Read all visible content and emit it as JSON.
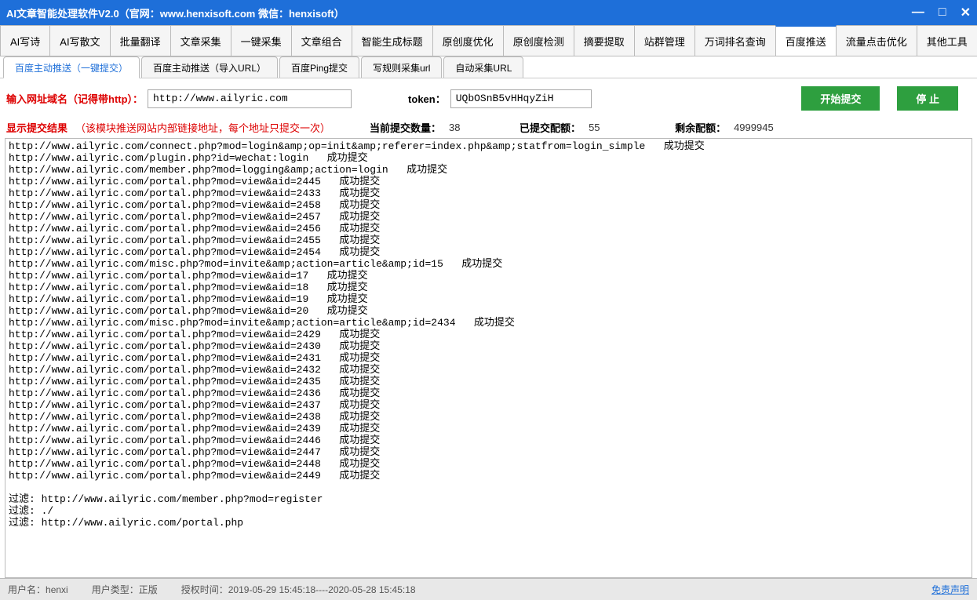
{
  "window": {
    "title": "AI文章智能处理软件V2.0（官网：www.henxisoft.com  微信：henxisoft）"
  },
  "main_tabs": [
    "AI写诗",
    "AI写散文",
    "批量翻译",
    "文章采集",
    "一键采集",
    "文章组合",
    "智能生成标题",
    "原创度优化",
    "原创度检测",
    "摘要提取",
    "站群管理",
    "万词排名查询",
    "百度推送",
    "流量点击优化",
    "其他工具"
  ],
  "main_tab_active": 12,
  "sub_tabs": [
    "百度主动推送（一键提交）",
    "百度主动推送（导入URL）",
    "百度Ping提交",
    "写规则采集url",
    "自动采集URL"
  ],
  "sub_tab_active": 0,
  "form": {
    "url_label": "输入网址域名（记得带http）：",
    "url_value": "http://www.ailyric.com",
    "token_label": "token：",
    "token_value": "UQbOSnB5vHHqyZiH",
    "start_btn": "开始提交",
    "stop_btn": "停  止"
  },
  "stats": {
    "result_label": "显示提交结果",
    "result_note": "（该模块推送网站内部链接地址，每个地址只提交一次）",
    "current_label": "当前提交数量：",
    "current_value": "38",
    "submitted_label": "已提交配额：",
    "submitted_value": "55",
    "remaining_label": "剩余配额：",
    "remaining_value": "4999945"
  },
  "log_lines": [
    "http://www.ailyric.com/connect.php?mod=login&amp;op=init&amp;referer=index.php&amp;statfrom=login_simple   成功提交",
    "http://www.ailyric.com/plugin.php?id=wechat:login   成功提交",
    "http://www.ailyric.com/member.php?mod=logging&amp;action=login   成功提交",
    "http://www.ailyric.com/portal.php?mod=view&aid=2445   成功提交",
    "http://www.ailyric.com/portal.php?mod=view&aid=2433   成功提交",
    "http://www.ailyric.com/portal.php?mod=view&aid=2458   成功提交",
    "http://www.ailyric.com/portal.php?mod=view&aid=2457   成功提交",
    "http://www.ailyric.com/portal.php?mod=view&aid=2456   成功提交",
    "http://www.ailyric.com/portal.php?mod=view&aid=2455   成功提交",
    "http://www.ailyric.com/portal.php?mod=view&aid=2454   成功提交",
    "http://www.ailyric.com/misc.php?mod=invite&amp;action=article&amp;id=15   成功提交",
    "http://www.ailyric.com/portal.php?mod=view&aid=17   成功提交",
    "http://www.ailyric.com/portal.php?mod=view&aid=18   成功提交",
    "http://www.ailyric.com/portal.php?mod=view&aid=19   成功提交",
    "http://www.ailyric.com/portal.php?mod=view&aid=20   成功提交",
    "http://www.ailyric.com/misc.php?mod=invite&amp;action=article&amp;id=2434   成功提交",
    "http://www.ailyric.com/portal.php?mod=view&aid=2429   成功提交",
    "http://www.ailyric.com/portal.php?mod=view&aid=2430   成功提交",
    "http://www.ailyric.com/portal.php?mod=view&aid=2431   成功提交",
    "http://www.ailyric.com/portal.php?mod=view&aid=2432   成功提交",
    "http://www.ailyric.com/portal.php?mod=view&aid=2435   成功提交",
    "http://www.ailyric.com/portal.php?mod=view&aid=2436   成功提交",
    "http://www.ailyric.com/portal.php?mod=view&aid=2437   成功提交",
    "http://www.ailyric.com/portal.php?mod=view&aid=2438   成功提交",
    "http://www.ailyric.com/portal.php?mod=view&aid=2439   成功提交",
    "http://www.ailyric.com/portal.php?mod=view&aid=2446   成功提交",
    "http://www.ailyric.com/portal.php?mod=view&aid=2447   成功提交",
    "http://www.ailyric.com/portal.php?mod=view&aid=2448   成功提交",
    "http://www.ailyric.com/portal.php?mod=view&aid=2449   成功提交",
    "",
    "过滤: http://www.ailyric.com/member.php?mod=register",
    "过滤: ./",
    "过滤: http://www.ailyric.com/portal.php"
  ],
  "status": {
    "user_label": "用户名：",
    "user_value": "henxi",
    "type_label": "用户类型：",
    "type_value": "正版",
    "auth_label": "授权时间：",
    "auth_value": "2019-05-29 15:45:18----2020-05-28 15:45:18",
    "disclaimer": "免责声明"
  }
}
